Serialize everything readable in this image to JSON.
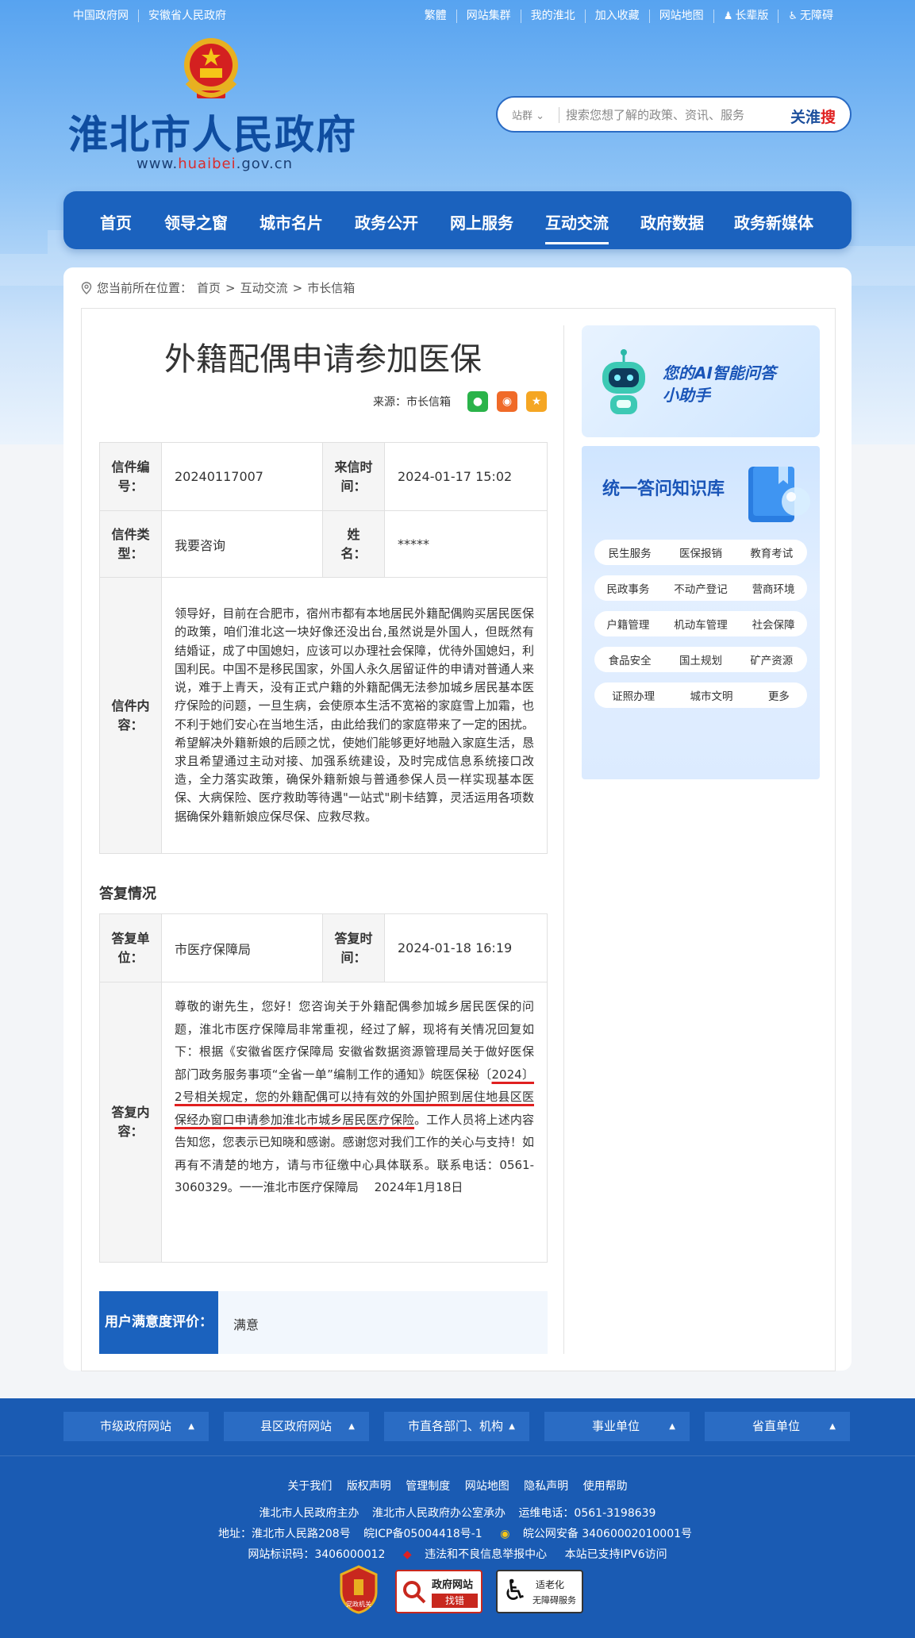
{
  "topbar": {
    "left_links": [
      "中国政府网",
      "安徽省人民政府"
    ],
    "right_links": [
      "繁體",
      "网站集群",
      "我的淮北",
      "加入收藏",
      "网站地图"
    ],
    "elder_mode": "长辈版",
    "accessibility": "无障碍"
  },
  "brand": {
    "title": "淮北市人民政府",
    "url_prefix": "www.",
    "url_highlight": "huaibei",
    "url_suffix": ".gov.cn"
  },
  "search": {
    "scope": "站群",
    "placeholder": "搜索您想了解的政策、资讯、服务",
    "button_left": "关淮",
    "button_right": "搜"
  },
  "nav": {
    "items": [
      "首页",
      "领导之窗",
      "城市名片",
      "政务公开",
      "网上服务",
      "互动交流",
      "政府数据",
      "政务新媒体"
    ],
    "active": "互动交流"
  },
  "breadcrumb": {
    "prefix": "您当前所在位置：",
    "items": [
      "首页",
      "互动交流",
      "市长信箱"
    ],
    "separator": ">"
  },
  "article": {
    "title": "外籍配偶申请参加医保",
    "source": "来源：市长信箱",
    "share_icons": [
      "wechat-icon",
      "weibo-icon",
      "favorite-icon"
    ]
  },
  "letter": {
    "id_label": "信件编号：",
    "id": "20240117007",
    "time_label": "来信时间：",
    "time": "2024-01-17 15:02",
    "type_label": "信件类型：",
    "type": "我要咨询",
    "name_label": "姓　　名：",
    "name": "*****",
    "content_label": "信件内容：",
    "content": "领导好，目前在合肥市，宿州市都有本地居民外籍配偶购买居民医保的政策，咱们淮北这一块好像还没出台,虽然说是外国人，但既然有结婚证，成了中国媳妇，应该可以办理社会保障，优待外国媳妇，利国利民。中国不是移民国家，外国人永久居留证件的申请对普通人来说，难于上青天，没有正式户籍的外籍配偶无法参加城乡居民基本医疗保险的问题，一旦生病，会使原本生活不宽裕的家庭雪上加霜，也不利于她们安心在当地生活，由此给我们的家庭带来了一定的困扰。希望解决外籍新娘的后顾之忧，使她们能够更好地融入家庭生活，恳求且希望通过主动对接、加强系统建设，及时完成信息系统接口改造，全力落实政策，确保外籍新娘与普通参保人员一样实现基本医保、大病保险、医疗救助等待遇\"一站式\"刷卡结算，灵活运用各项数据确保外籍新娘应保尽保、应救尽救。"
  },
  "reply": {
    "heading": "答复情况",
    "unit_label": "答复单位：",
    "unit": "市医疗保障局",
    "time_label": "答复时间：",
    "time": "2024-01-18 16:19",
    "content_label": "答复内容：",
    "content_before": "尊敬的谢先生，您好！您咨询关于外籍配偶参加城乡居民医保的问题，淮北市医疗保障局非常重视，经过了解，现将有关情况回复如下：根据《安徽省医疗保障局 安徽省数据资源管理局关于做好医保部门政务服务事项“全省一单”编制工作的通知》皖医保秘〔",
    "content_highlight": "2024〕2号相关规定，您的外籍配偶可以持有效的外国护照到居住地县区医保经办窗口申请参加淮北市城乡居民医疗保险",
    "content_after": "。工作人员将上述内容告知您，您表示已知晓和感谢。感谢您对我们工作的关心与支持！如再有不清楚的地方，请与市征缴中心具体联系。联系电话：0561-3060329。一一淮北市医疗保障局　 2024年1月18日"
  },
  "rating": {
    "label": "用户满意度评价：",
    "value": "满意"
  },
  "ai_card": {
    "line1": "您的AI智能问答",
    "line2": "小助手"
  },
  "kb": {
    "title": "统一答问知识库",
    "rows": [
      [
        "民生服务",
        "医保报销",
        "教育考试"
      ],
      [
        "民政事务",
        "不动产登记",
        "营商环境"
      ],
      [
        "户籍管理",
        "机动车管理",
        "社会保障"
      ],
      [
        "食品安全",
        "国土规划",
        "矿产资源"
      ],
      [
        "证照办理",
        "城市文明",
        "更多"
      ]
    ]
  },
  "footer": {
    "dropdowns": [
      "市级政府网站",
      "县区政府网站",
      "市直各部门、机构",
      "事业单位",
      "省直单位"
    ],
    "links": [
      "关于我们",
      "版权声明",
      "管理制度",
      "网站地图",
      "隐私声明",
      "使用帮助"
    ],
    "host": "淮北市人民政府主办",
    "organizer": "淮北市人民政府办公室承办",
    "ops_phone": "运维电话：0561-3198639",
    "address": "地址：淮北市人民路208号",
    "icp": "皖ICP备05004418号-1",
    "police": "皖公网安备 34060002010001号",
    "site_code": "网站标识码：3406000012",
    "report": "违法和不良信息举报中心",
    "ipv6": "本站已支持IPV6访问",
    "badge_gov": "党政机关",
    "badge_error_top": "政府网站",
    "badge_error_bottom": "找错",
    "badge_elder_top": "适老化",
    "badge_elder_bottom": "无障碍服务"
  },
  "colors": {
    "primary": "#1b62be",
    "footer": "#1a5bb3",
    "title_blue": "#0f4da0",
    "highlight_red": "#e02020"
  }
}
